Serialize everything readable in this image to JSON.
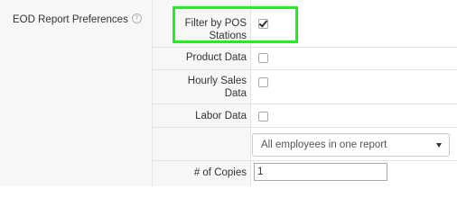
{
  "section": {
    "title": "EOD Report Preferences",
    "help_icon": "question-circle-icon",
    "help_glyph": "?"
  },
  "options": {
    "filter_by_pos": {
      "label_line1": "Filter by POS",
      "label_line2": "Stations",
      "checked": true
    },
    "product_data": {
      "label": "Product Data",
      "checked": false
    },
    "hourly_sales": {
      "label_line1": "Hourly Sales",
      "label_line2": "Data",
      "checked": false
    },
    "labor_data": {
      "label": "Labor Data",
      "checked": false
    },
    "report_grouping": {
      "selected": "All employees in one report",
      "icon": "caret-down-icon"
    },
    "copies": {
      "label": "# of Copies",
      "value": "1"
    }
  },
  "colors": {
    "highlight": "#22ee22",
    "panel_background": "#f7f7f7",
    "border": "#e4e4e4"
  }
}
